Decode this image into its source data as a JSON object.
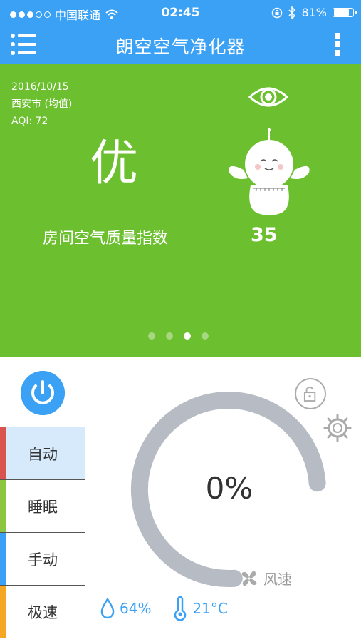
{
  "status_bar": {
    "carrier": "中国联通",
    "time": "02:45",
    "battery": "81%",
    "battery_level": 0.81,
    "signal_bars": 3
  },
  "nav": {
    "title": "朗空空气净化器",
    "menu_icon": "hamburger-menu-icon",
    "more_icon": "more-vertical-icon"
  },
  "hero": {
    "date": "2016/10/15",
    "location": "西安市 (均值)",
    "aqi": "AQI: 72",
    "level": "优",
    "index_label": "房间空气质量指数",
    "index_value": "35",
    "page_count": 4,
    "active_page": 3,
    "color": "#6cbf2f"
  },
  "controls": {
    "modes": [
      {
        "label": "自动",
        "color": "#d9534f",
        "selected": true
      },
      {
        "label": "睡眠",
        "color": "#8cc63f",
        "selected": false
      },
      {
        "label": "手动",
        "color": "#3aa1f5",
        "selected": false
      },
      {
        "label": "极速",
        "color": "#f5a623",
        "selected": false
      }
    ],
    "fan_percent": "0%",
    "fan_label": "风速",
    "humidity": "64%",
    "temperature": "21°C"
  },
  "colors": {
    "accent": "#3aa1f5",
    "gauge_track": "#b7bcc4"
  }
}
